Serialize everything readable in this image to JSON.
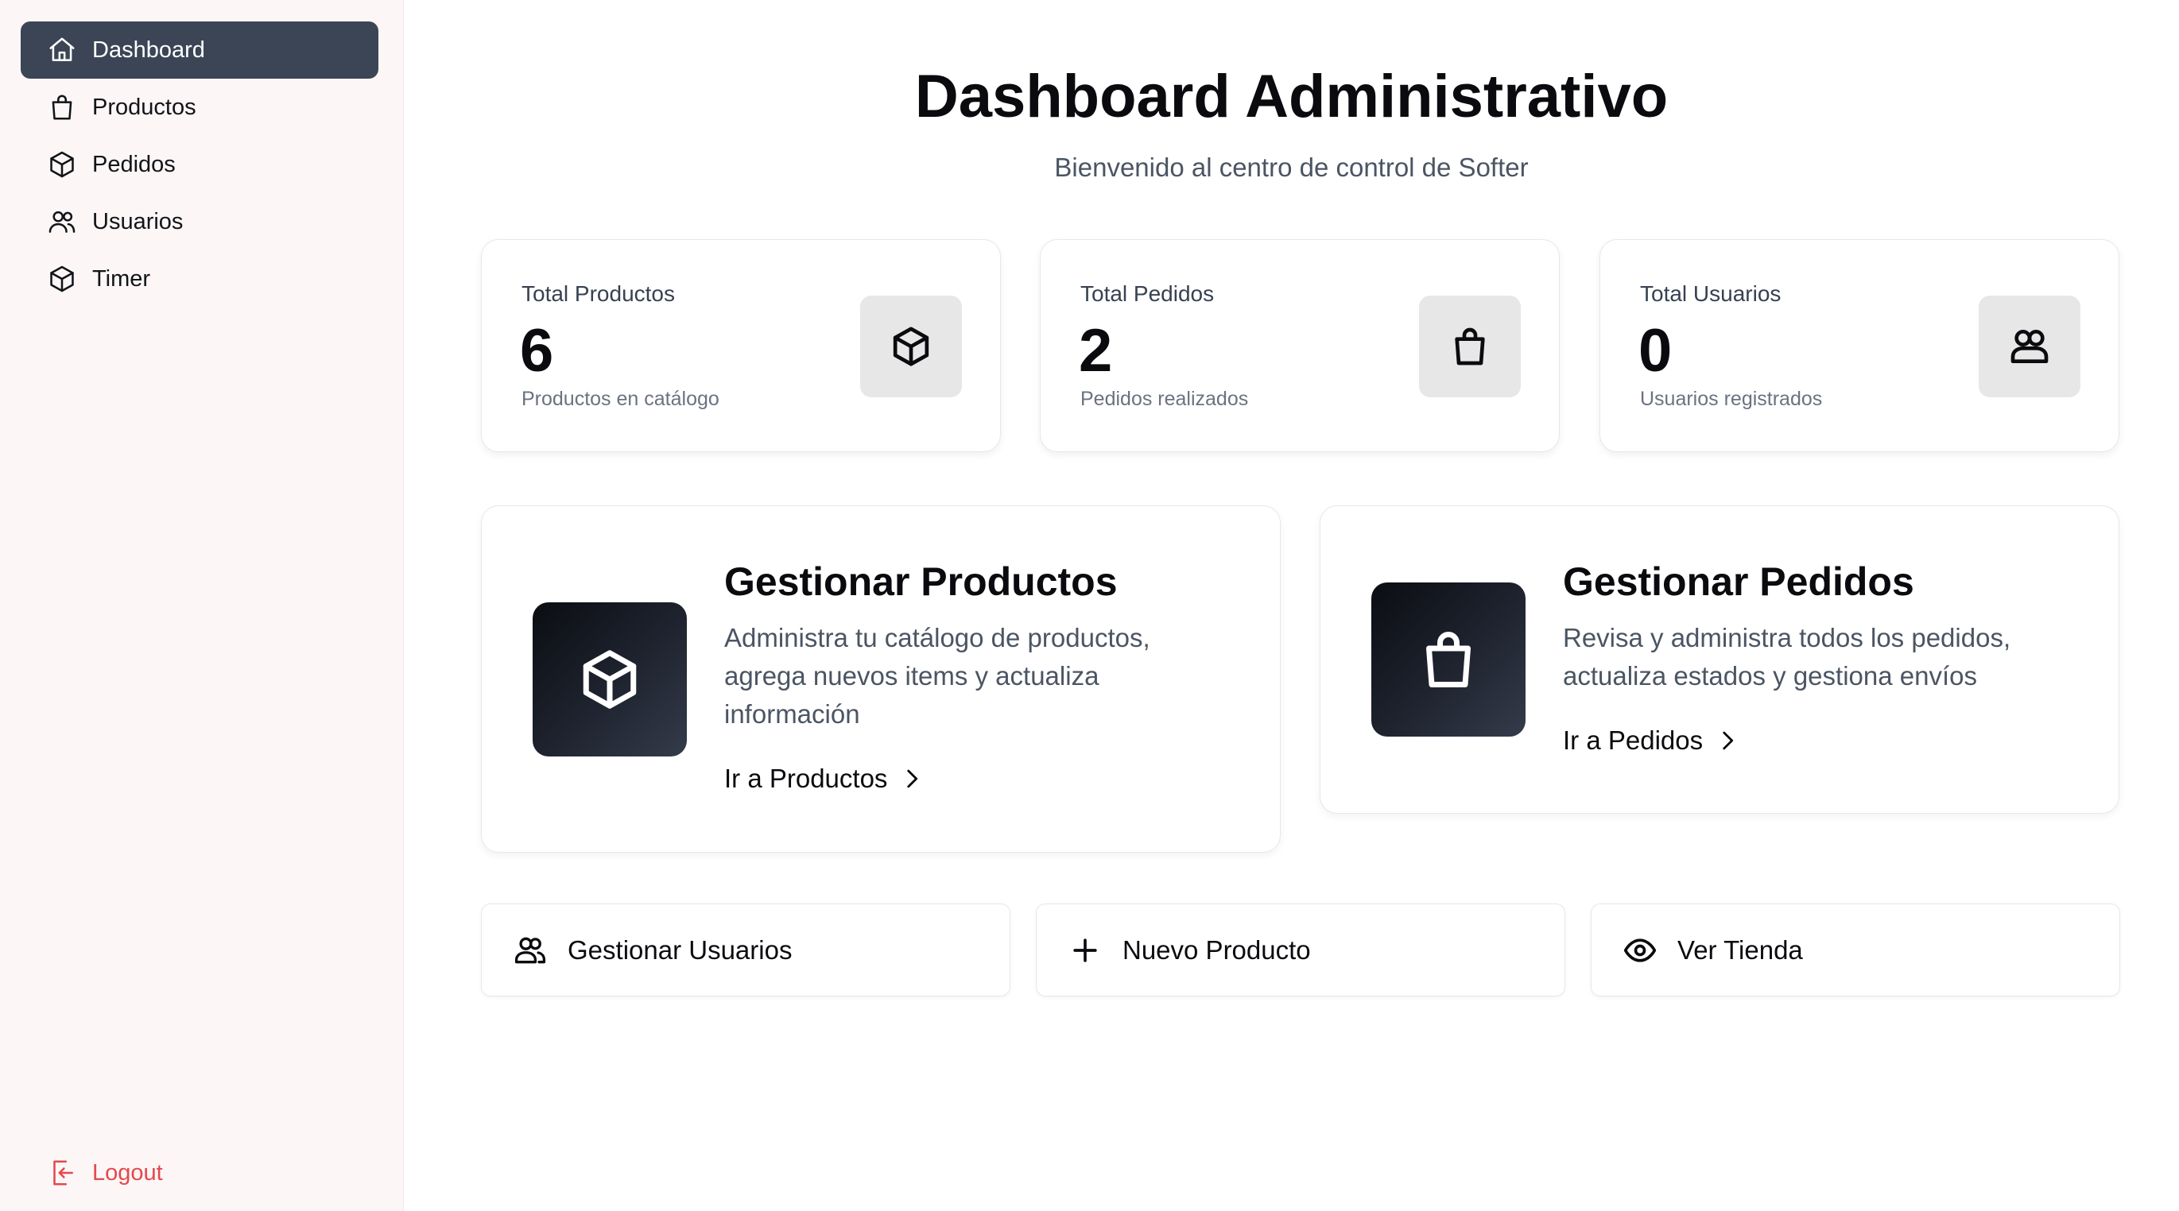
{
  "sidebar": {
    "items": [
      {
        "label": "Dashboard",
        "icon": "home-icon",
        "active": true
      },
      {
        "label": "Productos",
        "icon": "shopping-bag-icon",
        "active": false
      },
      {
        "label": "Pedidos",
        "icon": "package-icon",
        "active": false
      },
      {
        "label": "Usuarios",
        "icon": "users-icon",
        "active": false
      },
      {
        "label": "Timer",
        "icon": "package-icon",
        "active": false
      }
    ],
    "logout_label": "Logout",
    "logout_icon": "logout-icon",
    "active_color": "#3b4556",
    "logout_color": "#e5484d"
  },
  "header": {
    "title": "Dashboard Administrativo",
    "subtitle": "Bienvenido al centro de control de Softer"
  },
  "stats": [
    {
      "label": "Total Productos",
      "value": "6",
      "sub": "Productos en catálogo",
      "icon": "package-icon"
    },
    {
      "label": "Total Pedidos",
      "value": "2",
      "sub": "Pedidos realizados",
      "icon": "shopping-bag-icon"
    },
    {
      "label": "Total Usuarios",
      "value": "0",
      "sub": "Usuarios registrados",
      "icon": "users-icon"
    }
  ],
  "features": [
    {
      "title": "Gestionar Productos",
      "description": "Administra tu catálogo de productos, agrega nuevos items y actualiza información",
      "link": "Ir a Productos",
      "icon": "package-icon"
    },
    {
      "title": "Gestionar Pedidos",
      "description": "Revisa y administra todos los pedidos, actualiza estados y gestiona envíos",
      "link": "Ir a Pedidos",
      "icon": "shopping-bag-icon"
    }
  ],
  "actions": [
    {
      "label": "Gestionar Usuarios",
      "icon": "users-icon"
    },
    {
      "label": "Nuevo Producto",
      "icon": "plus-icon"
    },
    {
      "label": "Ver Tienda",
      "icon": "eye-icon"
    }
  ]
}
